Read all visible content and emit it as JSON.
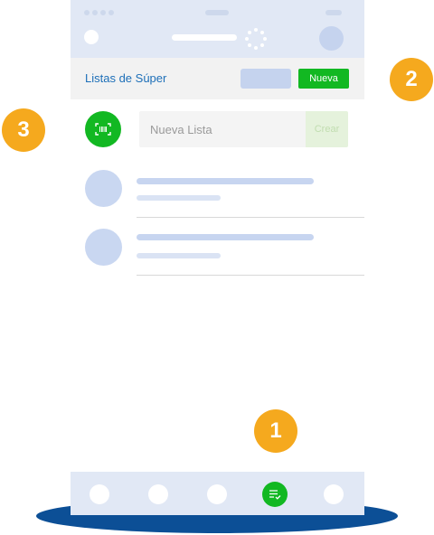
{
  "header": {
    "title": "Listas de Súper",
    "new_button_label": "Nueva"
  },
  "new_list": {
    "placeholder": "Nueva Lista",
    "create_button_label": "Crear"
  },
  "badges": [
    "1",
    "2",
    "3"
  ],
  "colors": {
    "accent_green": "#12b822",
    "badge_orange": "#f5a91e",
    "title_blue": "#1d6fb8",
    "skeleton_blue": "#c7d5f0",
    "base_navy": "#0c4f96"
  },
  "icons": {
    "scan": "barcode-scan-icon",
    "active_tab": "checklist-icon"
  }
}
